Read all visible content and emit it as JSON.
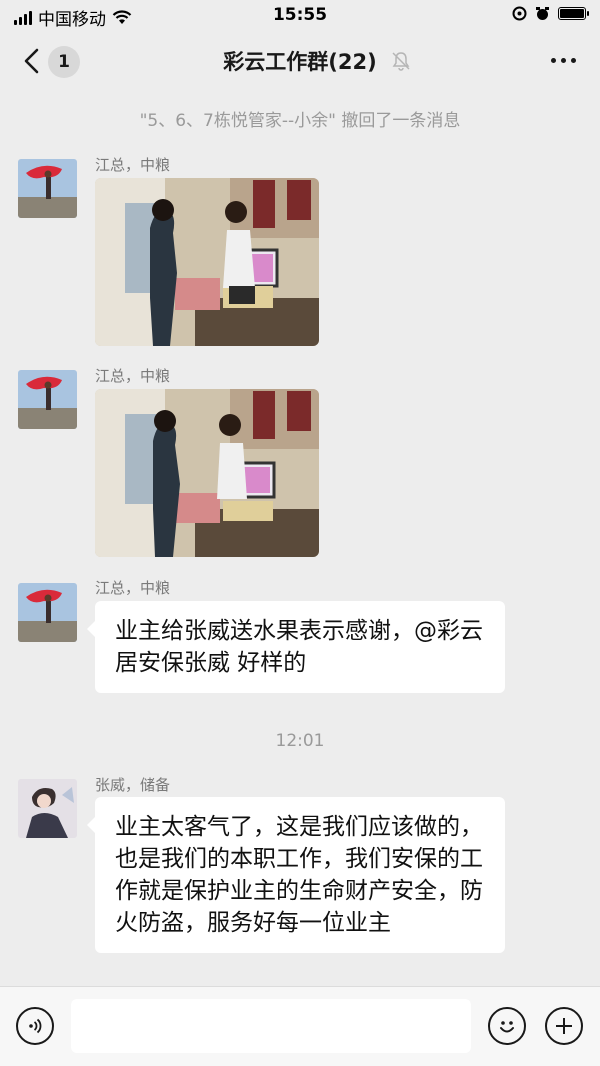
{
  "status_bar": {
    "carrier": "中国移动",
    "time": "15:55",
    "battery_level": 1.0
  },
  "nav": {
    "unread_count": "1",
    "title": "彩云工作群(22)",
    "icons": [
      "back-chevron-icon",
      "mute-bell-icon",
      "more-icon"
    ]
  },
  "system_message": "\"5、6、7栋悦管家--小余\" 撤回了一条消息",
  "messages": [
    {
      "sender": "江总，中粮",
      "type": "image"
    },
    {
      "sender": "江总，中粮",
      "type": "image"
    },
    {
      "sender": "江总，中粮",
      "type": "text",
      "text": "业主给张威送水果表示感谢，@彩云居安保张威 好样的"
    },
    {
      "sender": "张威，储备",
      "type": "text",
      "text": "业主太客气了，这是我们应该做的，也是我们的本职工作，我们安保的工作就是保护业主的生命财产安全，防火防盗，服务好每一位业主"
    }
  ],
  "time_divider": "12:01",
  "input_bar": {
    "icons": [
      "voice-icon",
      "emoji-icon",
      "add-icon"
    ],
    "input_value": ""
  }
}
